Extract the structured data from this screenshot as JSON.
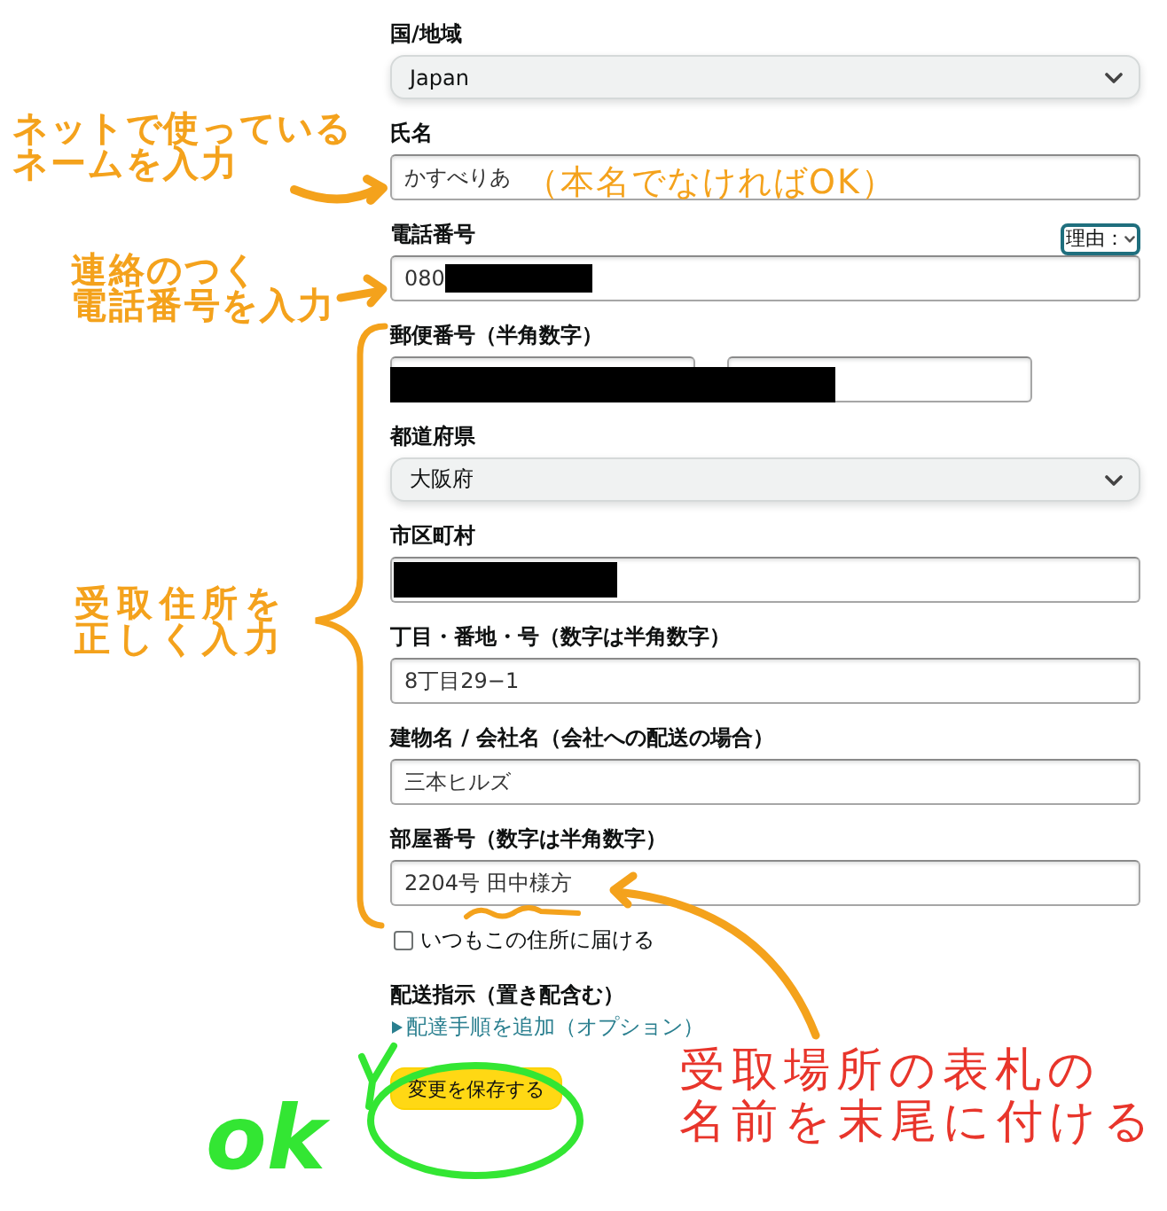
{
  "form": {
    "fields": [
      {
        "kind": "select",
        "label": "国/地域",
        "value": "Japan"
      },
      {
        "kind": "text",
        "label": "氏名",
        "value": "かすべりあ"
      },
      {
        "kind": "text",
        "label": "電話番号",
        "value": "080",
        "redacted": true,
        "reason_select": "理由："
      },
      {
        "kind": "postal",
        "label": "郵便番号（半角数字）",
        "redacted": true
      },
      {
        "kind": "select",
        "label": "都道府県",
        "value": "大阪府"
      },
      {
        "kind": "text",
        "label": "市区町村",
        "redacted": true
      },
      {
        "kind": "text",
        "label": "丁目・番地・号（数字は半角数字）",
        "value": "8丁目29−1"
      },
      {
        "kind": "text",
        "label": "建物名 / 会社名（会社への配送の場合）",
        "value": "三本ヒルズ"
      },
      {
        "kind": "text",
        "label": "部屋番号（数字は半角数字）",
        "value": "2204号 田中様方"
      }
    ],
    "always_deliver": {
      "label": "いつもこの住所に届ける",
      "checked": false
    },
    "delivery_instructions": {
      "label": "配送指示（置き配含む）",
      "link": "配達手順を追加（オプション）"
    },
    "save_button": "変更を保存する"
  },
  "annotations": [
    {
      "kind": "note",
      "color": "#f4a21c",
      "lines": [
        "ネットで使っている",
        "ネームを入力"
      ]
    },
    {
      "kind": "field_note",
      "color": "#f4a21c",
      "lines": [
        "（本名でなければOK）"
      ]
    },
    {
      "kind": "note",
      "color": "#f4a21c",
      "lines": [
        "連絡のつく",
        "電話番号を入力"
      ]
    },
    {
      "kind": "note",
      "color": "#f4a21c",
      "lines": [
        "受取住所を",
        "正しく入力"
      ]
    },
    {
      "kind": "callout",
      "color": "#e8352b",
      "lines": [
        "受取場所の表札の",
        "名前を末尾に付ける"
      ]
    },
    {
      "kind": "handwriting",
      "color": "#33e633",
      "lines": [
        "ok"
      ]
    }
  ]
}
